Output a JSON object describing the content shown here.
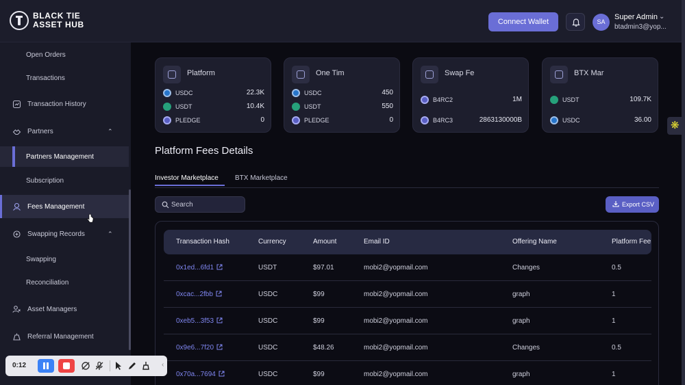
{
  "brand": {
    "line1": "BLACK TIE",
    "line2": "ASSET HUB"
  },
  "header": {
    "connect_label": "Connect Wallet",
    "avatar_initials": "SA",
    "user_name": "Super Admin",
    "user_email": "btadmin3@yop..."
  },
  "sidebar": {
    "items": [
      {
        "label": "Open Orders"
      },
      {
        "label": "Transactions"
      },
      {
        "label": "Transaction History"
      },
      {
        "label": "Partners"
      },
      {
        "label": "Partners Management"
      },
      {
        "label": "Subscription"
      },
      {
        "label": "Fees Management"
      },
      {
        "label": "Swapping Records"
      },
      {
        "label": "Swapping"
      },
      {
        "label": "Reconciliation"
      },
      {
        "label": "Asset Managers"
      },
      {
        "label": "Referral Management"
      }
    ]
  },
  "cards": [
    {
      "title": "Platform",
      "rows": [
        {
          "coin": "USDC",
          "value": "22.3K"
        },
        {
          "coin": "USDT",
          "value": "10.4K"
        },
        {
          "coin": "PLEDGE",
          "value": "0"
        }
      ]
    },
    {
      "title": "One Tim",
      "rows": [
        {
          "coin": "USDC",
          "value": "450"
        },
        {
          "coin": "USDT",
          "value": "550"
        },
        {
          "coin": "PLEDGE",
          "value": "0"
        }
      ]
    },
    {
      "title": "Swap Fe",
      "rows": [
        {
          "coin": "B4RC2",
          "value": "1M"
        },
        {
          "coin": "B4RC3",
          "value": "2863130000B"
        }
      ]
    },
    {
      "title": "BTX Mar",
      "rows": [
        {
          "coin": "USDT",
          "value": "109.7K"
        },
        {
          "coin": "USDC",
          "value": "36.00"
        }
      ]
    }
  ],
  "section_title": "Platform Fees Details",
  "tabs": [
    {
      "label": "Investor Marketplace"
    },
    {
      "label": "BTX Marketplace"
    }
  ],
  "search": {
    "placeholder": "Search"
  },
  "export_label": "Export CSV",
  "table": {
    "columns": [
      "Transaction Hash",
      "Currency",
      "Amount",
      "Email ID",
      "Offering Name",
      "Platform Fee"
    ],
    "rows": [
      {
        "hash": "0x1ed...6fd1",
        "currency": "USDT",
        "amount": "$97.01",
        "email": "mobi2@yopmail.com",
        "offering": "Changes",
        "fee": "0.5"
      },
      {
        "hash": "0xcac...2fbb",
        "currency": "USDC",
        "amount": "$99",
        "email": "mobi2@yopmail.com",
        "offering": "graph",
        "fee": "1"
      },
      {
        "hash": "0xeb5...3f53",
        "currency": "USDC",
        "amount": "$99",
        "email": "mobi2@yopmail.com",
        "offering": "graph",
        "fee": "1"
      },
      {
        "hash": "0x9e6...7f20",
        "currency": "USDC",
        "amount": "$48.26",
        "email": "mobi2@yopmail.com",
        "offering": "Changes",
        "fee": "0.5"
      },
      {
        "hash": "0x70a...7694",
        "currency": "USDC",
        "amount": "$99",
        "email": "mobi2@yopmail.com",
        "offering": "graph",
        "fee": "1"
      }
    ]
  },
  "recorder": {
    "time": "0:12"
  },
  "colors": {
    "accent": "#6a6ed6",
    "link": "#7f86f0",
    "background": "#0b0b12",
    "sidebar": "#1a1b28"
  }
}
